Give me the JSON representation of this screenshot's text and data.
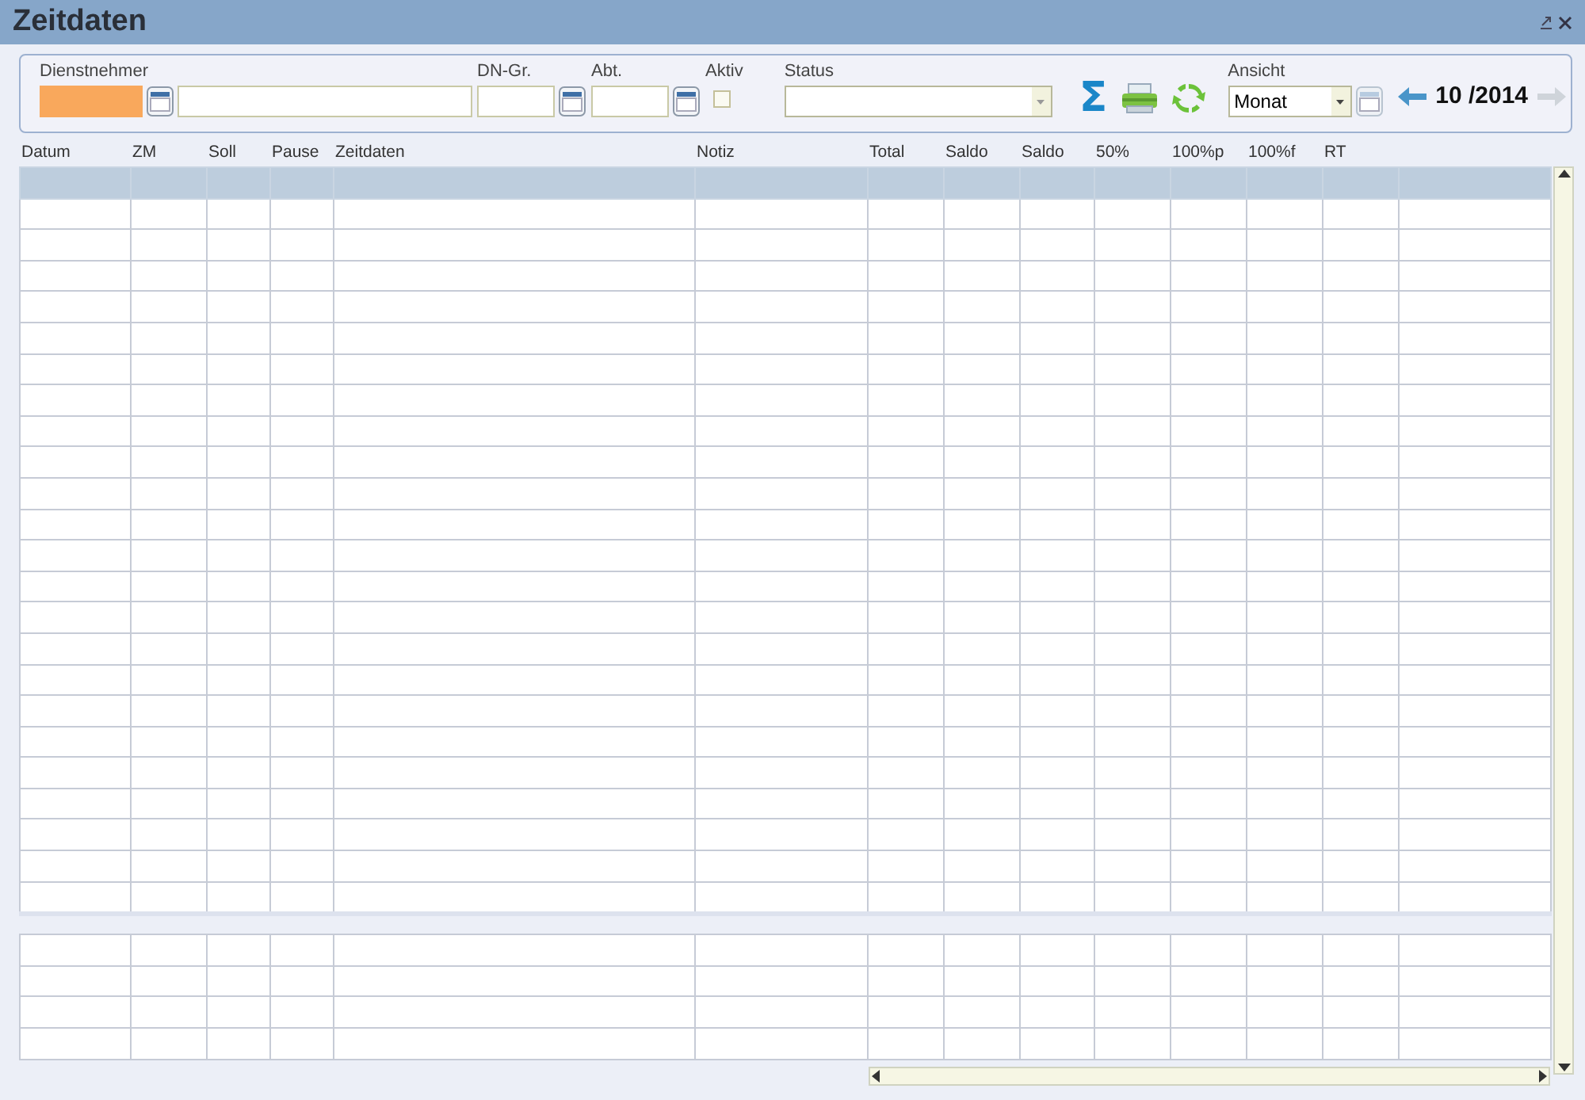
{
  "window": {
    "title": "Zeitdaten"
  },
  "filters": {
    "employee": {
      "label": "Dienstnehmer",
      "highlighted": true
    },
    "group": {
      "label": "DN-Gr."
    },
    "department": {
      "label": "Abt."
    },
    "active": {
      "label": "Aktiv",
      "checked": false
    },
    "status": {
      "label": "Status"
    },
    "view": {
      "label": "Ansicht",
      "value": "Monat"
    }
  },
  "toolbar": [
    {
      "kind": "sum",
      "label": "Σ"
    },
    {
      "kind": "print"
    },
    {
      "kind": "refresh"
    }
  ],
  "period": {
    "label": "10 /2014",
    "prev_disabled": false,
    "next_disabled": true
  },
  "table": {
    "columns": [
      "Datum",
      "ZM",
      "Soll",
      "Pause",
      "Zeitdaten",
      "Notiz",
      "Total",
      "Saldo",
      "Saldo",
      "50%",
      "100%p",
      "100%f",
      "RT",
      ""
    ],
    "rows": [
      {
        "selected": true
      },
      {
        "selected": false
      },
      {
        "selected": false
      },
      {
        "selected": false
      },
      {
        "selected": false
      },
      {
        "selected": false
      },
      {
        "selected": false
      },
      {
        "selected": false
      },
      {
        "selected": false
      },
      {
        "selected": false
      },
      {
        "selected": false
      },
      {
        "selected": false
      },
      {
        "selected": false
      },
      {
        "selected": false
      },
      {
        "selected": false
      },
      {
        "selected": false
      },
      {
        "selected": false
      },
      {
        "selected": false
      },
      {
        "selected": false
      },
      {
        "selected": false
      },
      {
        "selected": false
      },
      {
        "selected": false
      },
      {
        "selected": false
      },
      {
        "selected": false
      }
    ]
  },
  "summary_table": {
    "rows": [
      {
        "selected": false
      },
      {
        "selected": false
      },
      {
        "selected": false
      },
      {
        "selected": false
      }
    ]
  }
}
